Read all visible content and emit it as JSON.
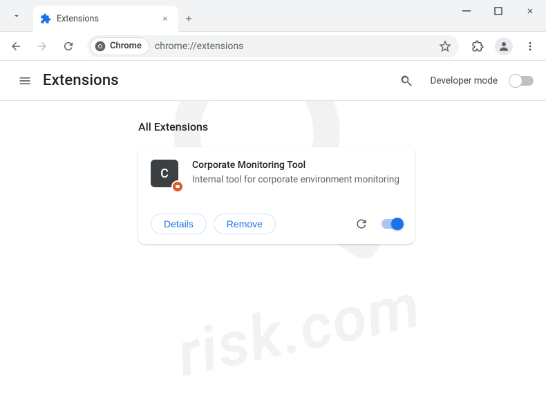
{
  "tab": {
    "title": "Extensions"
  },
  "omnibox": {
    "chip_label": "Chrome",
    "url": "chrome://extensions"
  },
  "header": {
    "title": "Extensions",
    "dev_mode_label": "Developer mode"
  },
  "section": {
    "title": "All Extensions"
  },
  "extension": {
    "icon_letter": "C",
    "name": "Corporate Monitoring Tool",
    "description": "Internal tool for corporate environment monitoring",
    "details_label": "Details",
    "remove_label": "Remove",
    "enabled": true
  },
  "watermark": {
    "text": "risk.com"
  }
}
